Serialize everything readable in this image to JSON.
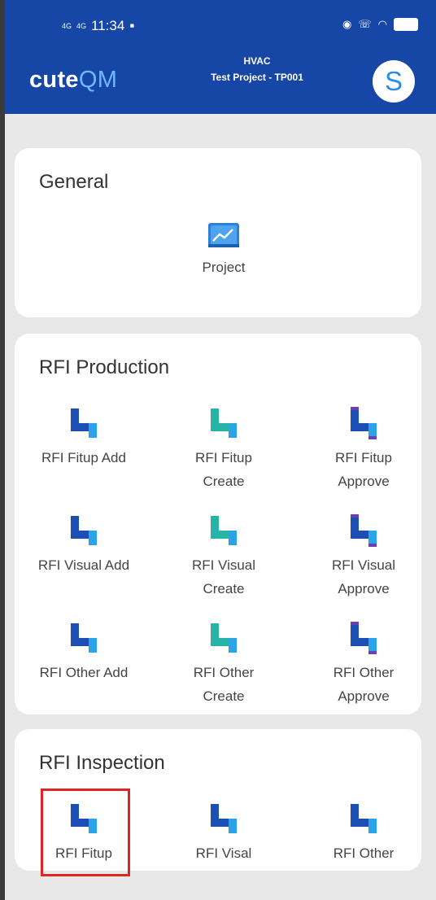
{
  "status_bar": {
    "time": "11:34",
    "net1": "4G",
    "net2": "4G"
  },
  "header": {
    "logo_main": "cute",
    "logo_accent": "QM",
    "line1": "HVAC",
    "line2": "Test Project - TP001",
    "avatar_letter": "S"
  },
  "colors": {
    "header_bg": "#1747a6",
    "icon_dark": "#1b4fb3",
    "icon_light": "#2aa3e8",
    "icon_teal": "#27b4a6",
    "icon_purple": "#6c3fb5",
    "highlight": "#e02424"
  },
  "sections": {
    "general": {
      "title": "General",
      "items": [
        {
          "label": "Project",
          "icon": "project-chart-icon"
        }
      ]
    },
    "production": {
      "title": "RFI Production",
      "items": [
        {
          "label_l1": "RFI Fitup Add",
          "label_l2": "",
          "icon": "pipe-icon"
        },
        {
          "label_l1": "RFI Fitup",
          "label_l2": "Create",
          "icon": "pipe-icon"
        },
        {
          "label_l1": "RFI Fitup",
          "label_l2": "Approve",
          "icon": "pipe-icon"
        },
        {
          "label_l1": "RFI Visual Add",
          "label_l2": "",
          "icon": "pipe-icon"
        },
        {
          "label_l1": "RFI Visual",
          "label_l2": "Create",
          "icon": "pipe-icon"
        },
        {
          "label_l1": "RFI Visual",
          "label_l2": "Approve",
          "icon": "pipe-icon"
        },
        {
          "label_l1": "RFI Other Add",
          "label_l2": "",
          "icon": "pipe-icon"
        },
        {
          "label_l1": "RFI Other",
          "label_l2": "Create",
          "icon": "pipe-icon"
        },
        {
          "label_l1": "RFI Other",
          "label_l2": "Approve",
          "icon": "pipe-icon"
        }
      ]
    },
    "inspection": {
      "title": "RFI Inspection",
      "items": [
        {
          "label": "RFI Fitup",
          "icon": "pipe-icon"
        },
        {
          "label": "RFI Visal",
          "icon": "pipe-icon"
        },
        {
          "label": "RFI Other",
          "icon": "pipe-icon"
        }
      ]
    }
  }
}
